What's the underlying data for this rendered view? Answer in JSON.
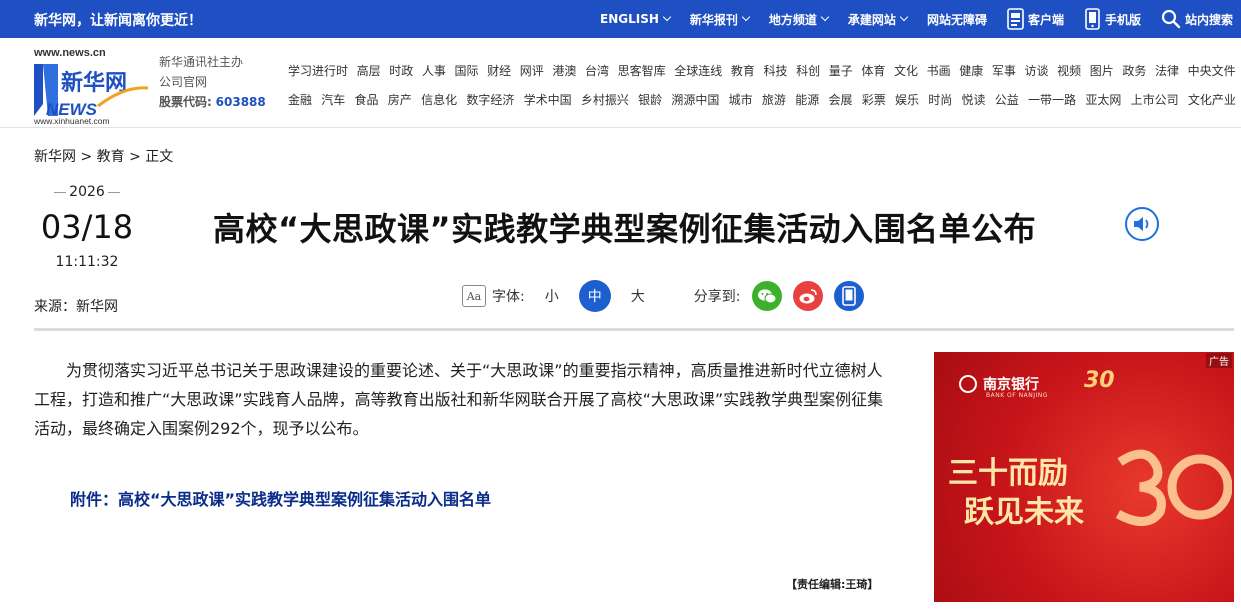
{
  "topbar": {
    "slogan": "新华网，让新闻离你更近！",
    "nav": [
      {
        "label": "ENGLISH",
        "dropdown": true
      },
      {
        "label": "新华报刊",
        "dropdown": true
      },
      {
        "label": "地方频道",
        "dropdown": true
      },
      {
        "label": "承建网站",
        "dropdown": true
      },
      {
        "label": "网站无障碍",
        "dropdown": false
      }
    ],
    "client_label": "客户端",
    "mobile_label": "手机版",
    "search_label": "站内搜索"
  },
  "header": {
    "logo_url_top": "www.news.cn",
    "logo_cn": "新华网",
    "logo_en": "NEWS",
    "logo_url_bottom": "www.xinhuanet.com",
    "org_line1": "新华通讯社主办",
    "org_line2": "公司官网",
    "stock_label": "股票代码:",
    "stock_code": "603888"
  },
  "channels": {
    "row1": [
      "学习进行时",
      "高层",
      "时政",
      "人事",
      "国际",
      "财经",
      "网评",
      "港澳",
      "台湾",
      "思客智库",
      "全球连线",
      "教育",
      "科技",
      "科创",
      "量子",
      "体育",
      "文化",
      "书画",
      "健康",
      "军事",
      "访谈",
      "视频",
      "图片",
      "政务",
      "法律",
      "中央文件"
    ],
    "row2": [
      "金融",
      "汽车",
      "食品",
      "房产",
      "信息化",
      "数字经济",
      "学术中国",
      "乡村振兴",
      "银龄",
      "溯源中国",
      "城市",
      "旅游",
      "能源",
      "会展",
      "彩票",
      "娱乐",
      "时尚",
      "悦读",
      "公益",
      "一带一路",
      "亚太网",
      "上市公司",
      "文化产业"
    ]
  },
  "breadcrumb": {
    "home": "新华网",
    "sep": ">",
    "section": "教育",
    "current": "正文"
  },
  "article": {
    "year": "2026",
    "month_day": "03/18",
    "time": "11:11:32",
    "source": "来源：新华网",
    "title": "高校“大思政课”实践教学典型案例征集活动入围名单公布",
    "font_label": "字体:",
    "font_sizes": [
      "小",
      "中",
      "大"
    ],
    "font_size_selected": "中",
    "share_label": "分享到:",
    "body": "为贯彻落实习近平总书记关于思政课建设的重要论述、关于“大思政课”的重要指示精神，高质量推进新时代立德树人工程，打造和推广“大思政课”实践育人品牌，高等教育出版社和新华网联合开展了高校“大思政课”实践教学典型案例征集活动，最终确定入围案例292个，现予以公布。",
    "attachment": "附件：高校“大思政课”实践教学典型案例征集活动入围名单",
    "editor": "【责任编辑:王琦】"
  },
  "ad": {
    "tag": "广告",
    "bank_name": "南京银行",
    "bank_en": "BANK OF NANJING",
    "anniversary": "30",
    "line1": "三十而励",
    "line2": "跃见未来"
  },
  "colors": {
    "brand_blue": "#1e4fc3",
    "attachment_blue": "#0a2d8c",
    "wechat_green": "#3db12c",
    "weibo_red": "#e8413f",
    "mobile_blue": "#1e5fd0"
  }
}
